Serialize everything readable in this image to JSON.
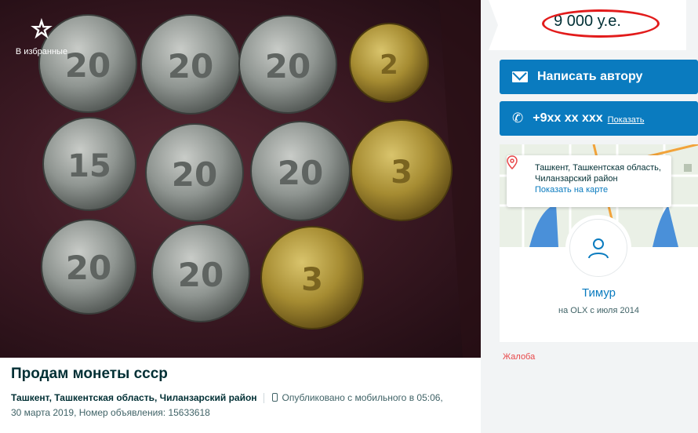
{
  "favorites": {
    "label": "В избранные",
    "icon": "star-outline-icon"
  },
  "ad": {
    "title": "Продам монеты ссср",
    "location": "Ташкент, Ташкентская область, Чиланзарский район",
    "published_text": "Опубликовано с мобильного",
    "published_at": "в 05:06,",
    "date_and_number": "30 марта 2019, Номер объявления: 15633618"
  },
  "price": {
    "value": "9 000 у.е.",
    "highlight_color": "#e21b1b"
  },
  "contact": {
    "message_button": "Написать автору",
    "message_icon": "envelope-icon",
    "phone_number": "+9xx xx xxx",
    "phone_show": "Показать",
    "phone_icon": "phone-icon",
    "button_color": "#0a7bbf"
  },
  "map": {
    "location_text": "Ташкент, Ташкентская область, Чиланзарский район",
    "show_on_map": "Показать на карте",
    "pin_icon": "map-pin-icon"
  },
  "seller": {
    "name": "Тимур",
    "since": "на OLX с июля 2014",
    "avatar_icon": "user-icon"
  },
  "complaint_link": "Жалоба"
}
